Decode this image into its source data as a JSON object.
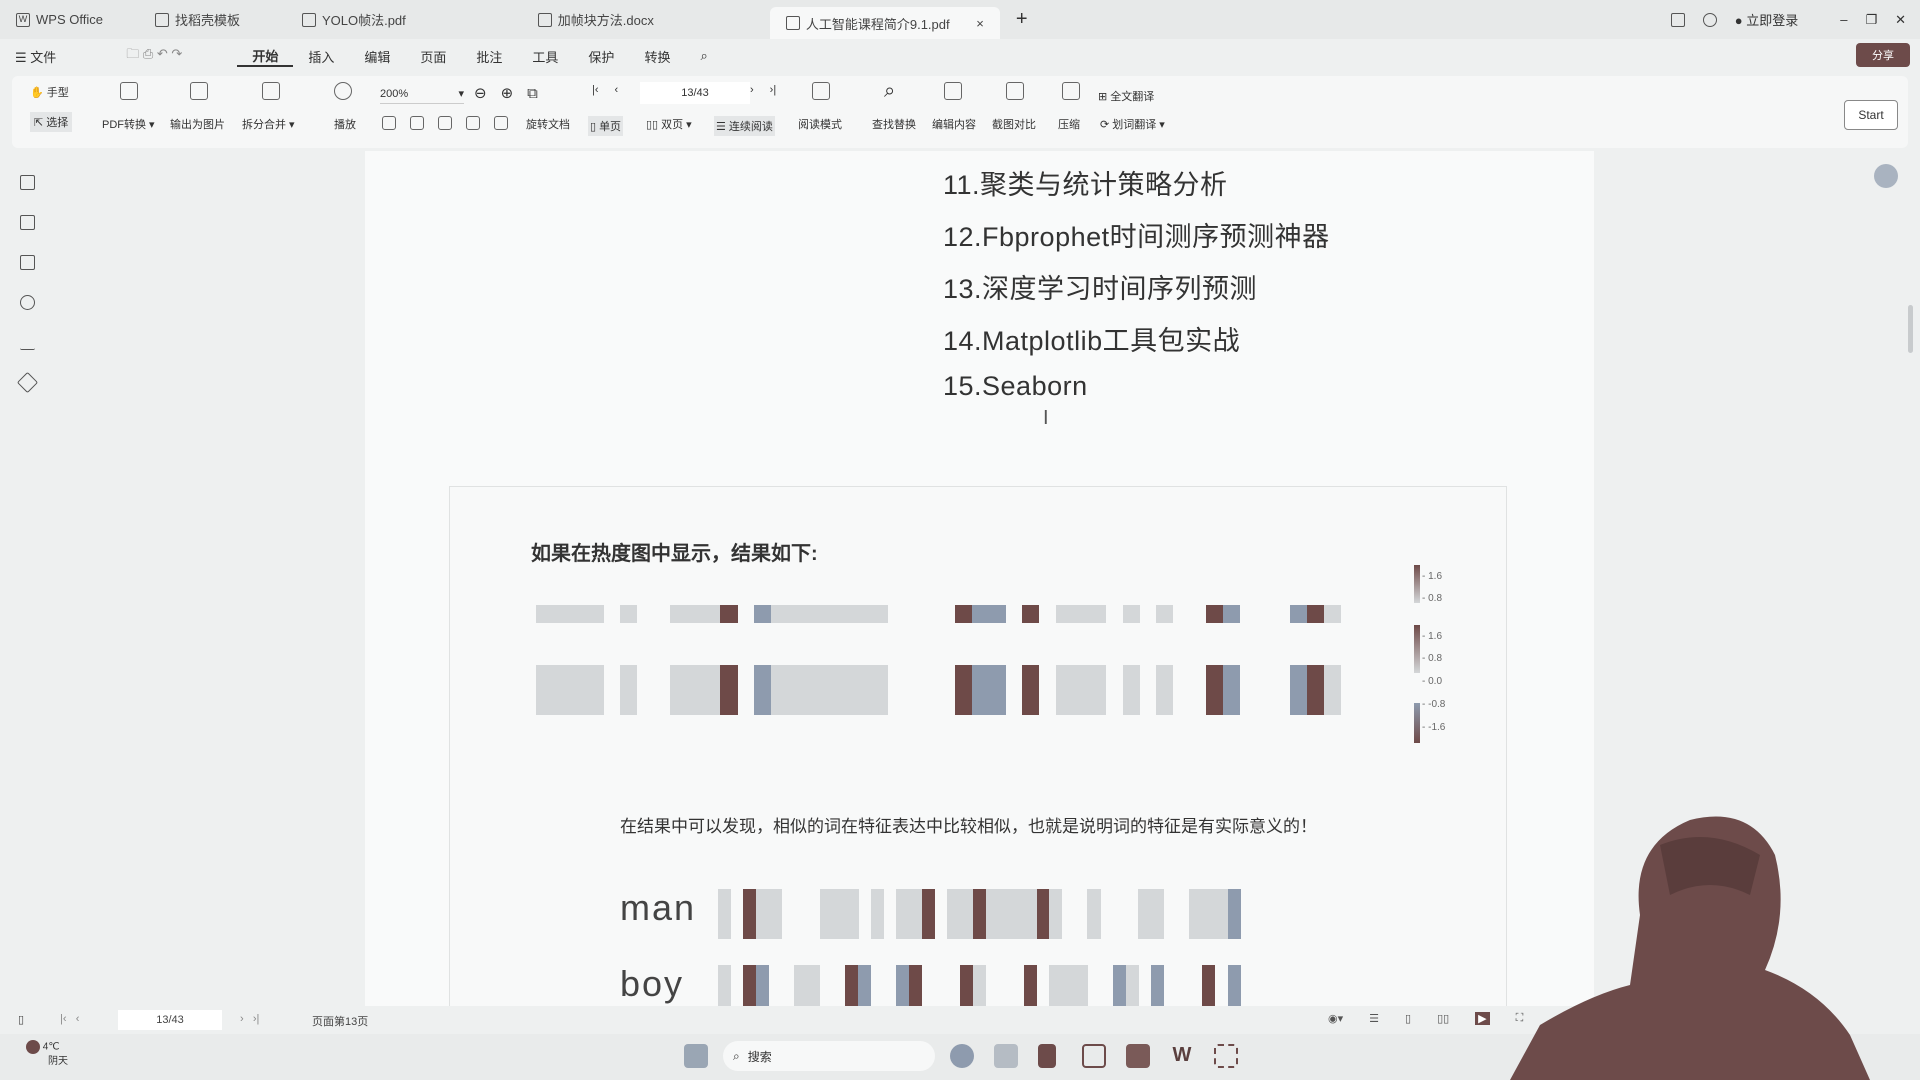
{
  "tabs": [
    {
      "label": "WPS Office",
      "icon": "wps-logo-icon"
    },
    {
      "label": "找稻壳模板",
      "icon": "docer-icon"
    },
    {
      "label": "YOLO帧法.pdf",
      "icon": "pdf-icon"
    },
    {
      "label": "加帧块方法.docx",
      "icon": "doc-icon"
    },
    {
      "label": "人工智能课程简介9.1.pdf",
      "icon": "pdf-icon",
      "active": true
    }
  ],
  "titlebar": {
    "login": "立即登录",
    "new_tab": "+"
  },
  "menu": {
    "file": "文件",
    "items": [
      "开始",
      "插入",
      "编辑",
      "页面",
      "批注",
      "工具",
      "保护",
      "转换"
    ],
    "active": "开始",
    "share": "分享"
  },
  "toolbar": {
    "hand": "手型",
    "select": "选择",
    "pdf_convert": "PDF转换",
    "export_image": "输出为图片",
    "split_merge": "拆分合并",
    "play": "播放",
    "zoom": "200%",
    "page": "13/43",
    "rotate": "旋转文档",
    "single": "单页",
    "double": "双页",
    "continuous": "连续阅读",
    "read_mode": "阅读模式",
    "find_replace": "查找替换",
    "edit_content": "编辑内容",
    "screenshot_compare": "截图对比",
    "compress": "压缩",
    "full_translate": "全文翻译",
    "word_translate": "划词翻译",
    "start": "Start"
  },
  "document": {
    "list": [
      "11.聚类与统计策略分析",
      "12.Fbprophet时间测序预测神器",
      "13.深度学习时间序列预测",
      "14.Matplotlib工具包实战",
      "15.Seaborn"
    ],
    "figure_title": "如果在热度图中显示，结果如下:",
    "sentence": "在结果中可以发现，相似的词在特征表达中比较相似，也就是说明词的特征是有实际意义的！",
    "words": [
      "man",
      "boy"
    ],
    "colorbar_ticks": [
      "1.6",
      "0.8",
      "1.6",
      "0.8",
      "0.0",
      "-0.8",
      "-1.6"
    ]
  },
  "heatmap": {
    "colors": {
      "high": "#6e4a48",
      "neg": "#8e9bae",
      "mid": "#d4d7d9",
      "low": "#e4e6e7"
    },
    "top_row": [
      0.3,
      0.3,
      0.3,
      0.3,
      0,
      0.3,
      0,
      0,
      0.3,
      0.3,
      0.3,
      1.6,
      0,
      -0.8,
      0.3,
      0.3,
      0.3,
      0.3,
      0.3,
      0.3,
      0.3,
      0,
      0,
      0,
      0,
      1.6,
      -0.8,
      -0.8,
      0,
      1.6,
      0,
      0.3,
      0.3,
      0.3,
      0,
      0.3,
      0,
      0.3,
      0,
      0,
      1.6,
      -0.8,
      0,
      0,
      0,
      -0.8,
      1.6,
      0.3,
      0,
      0
    ],
    "man": [
      0.3,
      0,
      1.6,
      0.3,
      0.3,
      0,
      0,
      0,
      0.3,
      0.3,
      0.3,
      0,
      0.3,
      0,
      0.3,
      0.3,
      1.6,
      0,
      0.3,
      0.3,
      1.6,
      0.3,
      0.3,
      0.3,
      0.3,
      1.6,
      0.3,
      0,
      0,
      0.3,
      0,
      0,
      0,
      0.3,
      0.3,
      0,
      0,
      0.3,
      0.3,
      0.3,
      -0.8,
      0,
      0,
      0,
      0,
      0,
      0,
      0,
      0,
      0
    ],
    "boy": [
      0.3,
      0,
      1.6,
      -0.8,
      0,
      0,
      0.3,
      0.3,
      0,
      0,
      1.6,
      -0.8,
      0,
      0,
      -0.8,
      1.6,
      0,
      0,
      0,
      1.6,
      0.3,
      0,
      0,
      0,
      1.6,
      0,
      0.3,
      0.3,
      0.3,
      0,
      0,
      -0.8,
      0.3,
      0,
      -0.8,
      0,
      0,
      0,
      1.6,
      0,
      -0.8,
      0,
      0,
      0,
      0,
      0,
      0,
      0,
      0,
      0
    ]
  },
  "statusbar": {
    "page": "13/43",
    "info": "页面第13页"
  },
  "taskbar": {
    "weather_temp": "4℃",
    "weather_text": "阴天",
    "search": "搜索"
  }
}
